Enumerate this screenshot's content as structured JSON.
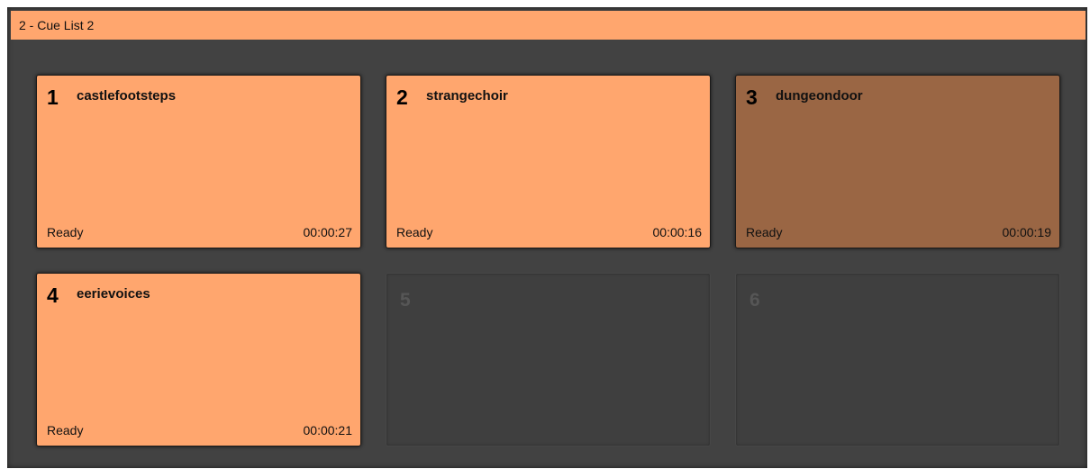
{
  "window": {
    "title": "2 - Cue List 2"
  },
  "colors": {
    "cue_orange": "#ffa66e",
    "cue_selected_brown": "#9a6644",
    "background": "#424242"
  },
  "cues": [
    {
      "number": "1",
      "name": "castlefootsteps",
      "status": "Ready",
      "duration": "00:00:27",
      "state": "loaded"
    },
    {
      "number": "2",
      "name": "strangechoir",
      "status": "Ready",
      "duration": "00:00:16",
      "state": "loaded"
    },
    {
      "number": "3",
      "name": "dungeondoor",
      "status": "Ready",
      "duration": "00:00:19",
      "state": "selected"
    },
    {
      "number": "4",
      "name": "eerievoices",
      "status": "Ready",
      "duration": "00:00:21",
      "state": "loaded"
    },
    {
      "number": "5",
      "state": "empty"
    },
    {
      "number": "6",
      "state": "empty"
    }
  ]
}
